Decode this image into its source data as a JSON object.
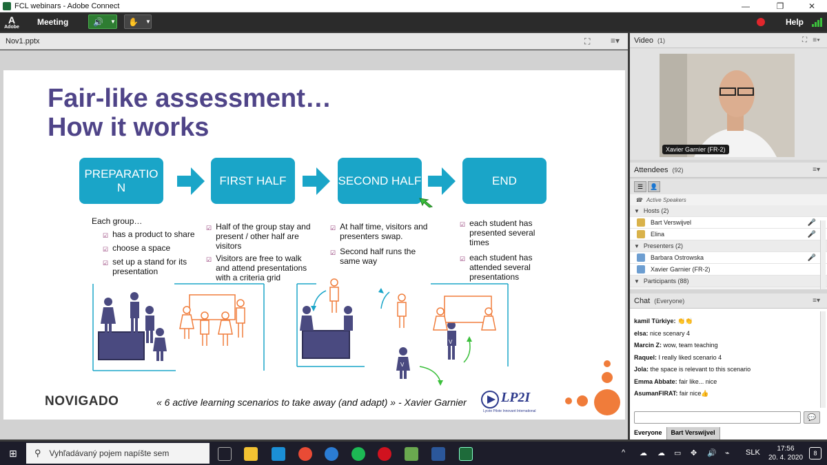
{
  "window": {
    "title": "FCL webinars - Adobe Connect",
    "minimize": "—",
    "maximize": "❐",
    "close": "✕"
  },
  "menubar": {
    "logo": "Adobe",
    "meeting_label": "Meeting",
    "help_label": "Help"
  },
  "share_pod": {
    "filename": "Nov1.pptx"
  },
  "slide": {
    "title_line1": "Fair-like assessment…",
    "title_line2": "How it works",
    "stages": [
      {
        "label": "PREPARATIO N"
      },
      {
        "label": "FIRST HALF"
      },
      {
        "label": "SECOND HALF"
      },
      {
        "label": "END"
      }
    ],
    "col1": {
      "intro": "Each group…",
      "bullets": [
        "has a product to share",
        "choose a space",
        "set up a stand for its presentation"
      ]
    },
    "col2": {
      "bullets": [
        "Half of the group stay and present / other half are visitors",
        "Visitors are free to walk and attend presentations with a criteria grid"
      ]
    },
    "col3": {
      "bullets": [
        "At half time, visitors and presenters swap.",
        "Second half runs the same way"
      ]
    },
    "col4": {
      "bullets": [
        "each student has presented several times",
        "each student has attended several presentations"
      ]
    },
    "figure_letter": "V",
    "footer_quote": "« 6 active learning scenarios to take away (and adapt) » - Xavier Garnier",
    "logo_novigado": "NOVIGADO",
    "logo_lpi": "LP2I",
    "logo_lpi_sub": "Lycée Pilote Innovant International"
  },
  "video_pod": {
    "title": "Video",
    "count": "(1)",
    "presenter_name": "Xavier Garnier (FR-2)"
  },
  "attendees_pod": {
    "title": "Attendees",
    "count": "(92)",
    "active_speakers": "Active Speakers",
    "hosts_label": "Hosts (2)",
    "hosts": [
      "Bart Verswijvel",
      "Elina"
    ],
    "presenters_label": "Presenters (2)",
    "presenters": [
      "Barbara Ostrowska",
      "Xavier Garnier (FR-2)"
    ],
    "participants_label": "Participants (88)"
  },
  "chat_pod": {
    "title": "Chat",
    "scope": "(Everyone)",
    "messages": [
      {
        "author": "kamil Türkiye:",
        "text": "👏👏"
      },
      {
        "author": "elsa:",
        "text": "nice scenary 4"
      },
      {
        "author": "Marcin Z:",
        "text": "wow, team teaching"
      },
      {
        "author": "Raquel:",
        "text": "I really liked scenario 4"
      },
      {
        "author": "Jola:",
        "text": "the space is relevant to this scenario"
      },
      {
        "author": "Emma Abbate:",
        "text": "fair like... nice"
      },
      {
        "author": "AsumanFIRAT:",
        "text": "fair nice👍"
      }
    ],
    "tabs": [
      "Everyone",
      "Bart Verswijvel"
    ]
  },
  "taskbar": {
    "search_placeholder": "Vyhľadávaný pojem napíšte sem",
    "language": "SLK",
    "time": "17:56",
    "date": "20. 4. 2020",
    "notifications": "8"
  },
  "colors": {
    "accent_teal": "#1aa5c8",
    "title_purple": "#4f4488",
    "recording_red": "#e0262c",
    "speaker_green": "#2e7d32"
  }
}
